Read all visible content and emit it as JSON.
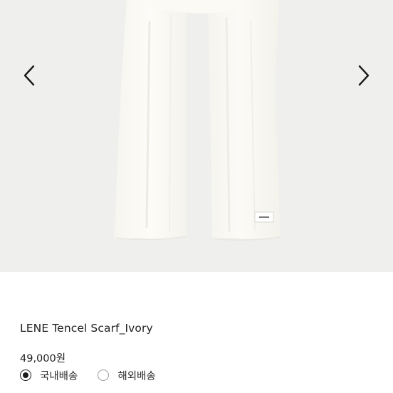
{
  "gallery": {
    "prev_icon": "chevron-left-icon",
    "next_icon": "chevron-right-icon",
    "background_color": "#efefed",
    "product_color": "#fbfaf5"
  },
  "product": {
    "title": "LENE Tencel Scarf_Ivory",
    "price": "49,000원"
  },
  "shipping": {
    "options": [
      {
        "label": "국내배송",
        "selected": true
      },
      {
        "label": "해외배송",
        "selected": false
      }
    ]
  }
}
